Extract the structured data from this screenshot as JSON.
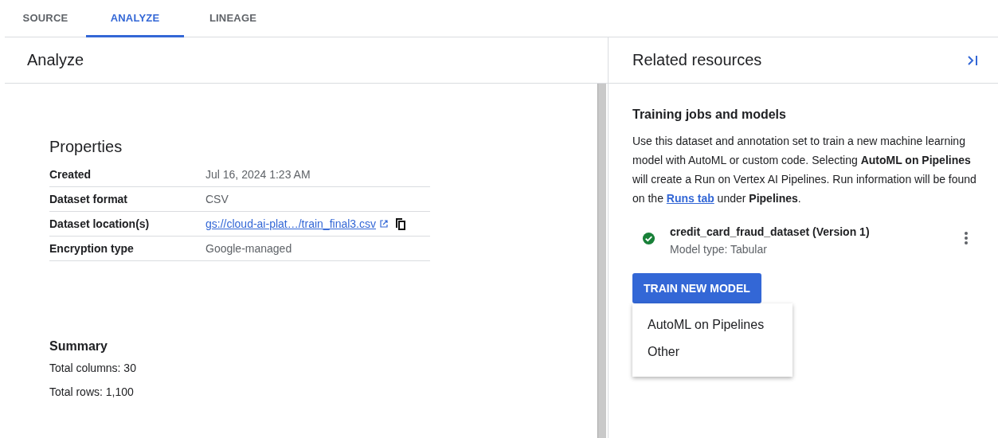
{
  "tabs": [
    {
      "label": "SOURCE",
      "selected": false
    },
    {
      "label": "ANALYZE",
      "selected": true
    },
    {
      "label": "LINEAGE",
      "selected": false
    }
  ],
  "analyze": {
    "title": "Analyze",
    "properties": {
      "title": "Properties",
      "rows": [
        {
          "label": "Created",
          "value": "Jul 16, 2024 1:23 AM",
          "kind": "text"
        },
        {
          "label": "Dataset format",
          "value": "CSV",
          "kind": "text"
        },
        {
          "label": "Dataset location(s)",
          "value": "gs://cloud-ai-plat…/train_final3.csv",
          "kind": "link"
        },
        {
          "label": "Encryption type",
          "value": "Google-managed",
          "kind": "text"
        }
      ]
    },
    "summary": {
      "title": "Summary",
      "lines": [
        "Total columns: 30",
        "Total rows: 1,100"
      ]
    }
  },
  "related": {
    "title": "Related resources",
    "section_title": "Training jobs and models",
    "description": {
      "before": "Use this dataset and annotation set to train a new machine learning model with AutoML or custom code. Selecting **AutoML on Pipelines** will create a Run on Vertex AI Pipelines. Run information will be found on the ",
      "link": "Runs tab",
      "after": " under **Pipelines**."
    },
    "models": [
      {
        "name": "credit_card_fraud_dataset (Version 1)",
        "subtitle": "Model type: Tabular",
        "succeeded": true
      }
    ],
    "button": "TRAIN NEW MODEL",
    "menu": [
      "AutoML on Pipelines",
      "Other"
    ]
  }
}
